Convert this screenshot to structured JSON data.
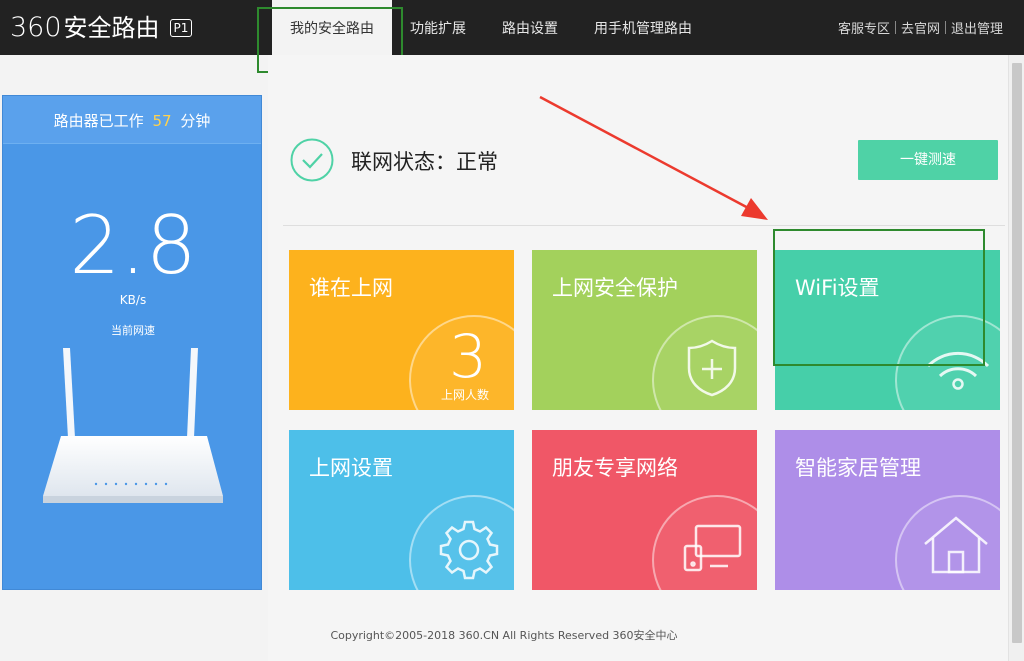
{
  "header": {
    "logo_number": "360",
    "logo_text": "安全路由",
    "logo_badge": "P1",
    "tabs": [
      {
        "label": "我的安全路由",
        "active": true
      },
      {
        "label": "功能扩展",
        "active": false
      },
      {
        "label": "路由设置",
        "active": false
      },
      {
        "label": "用手机管理路由",
        "active": false
      }
    ],
    "links": [
      "客服专区",
      "去官网",
      "退出管理"
    ]
  },
  "speed_panel": {
    "uptime_prefix": "路由器已工作",
    "uptime_minutes": "57",
    "uptime_suffix": "分钟",
    "speed_value": "2.8",
    "speed_unit": "KB/s",
    "speed_label": "当前网速"
  },
  "status": {
    "text": "联网状态：正常",
    "speedtest_label": "一键测速"
  },
  "tiles": [
    {
      "title": "谁在上网",
      "count": "3",
      "count_label": "上网人数",
      "color": "#fdb21d"
    },
    {
      "title": "上网安全保护",
      "icon": "shield-plus-icon",
      "color": "#a3d15c"
    },
    {
      "title": "WiFi设置",
      "icon": "wifi-icon",
      "color": "#46cfa9"
    },
    {
      "title": "上网设置",
      "icon": "gear-icon",
      "color": "#4dbfe9"
    },
    {
      "title": "朋友专享网络",
      "icon": "devices-icon",
      "color": "#f05767"
    },
    {
      "title": "智能家居管理",
      "icon": "house-icon",
      "color": "#ae8ee8"
    }
  ],
  "footer": {
    "text": "Copyright©2005-2018 360.CN All Rights Reserved 360安全中心"
  }
}
